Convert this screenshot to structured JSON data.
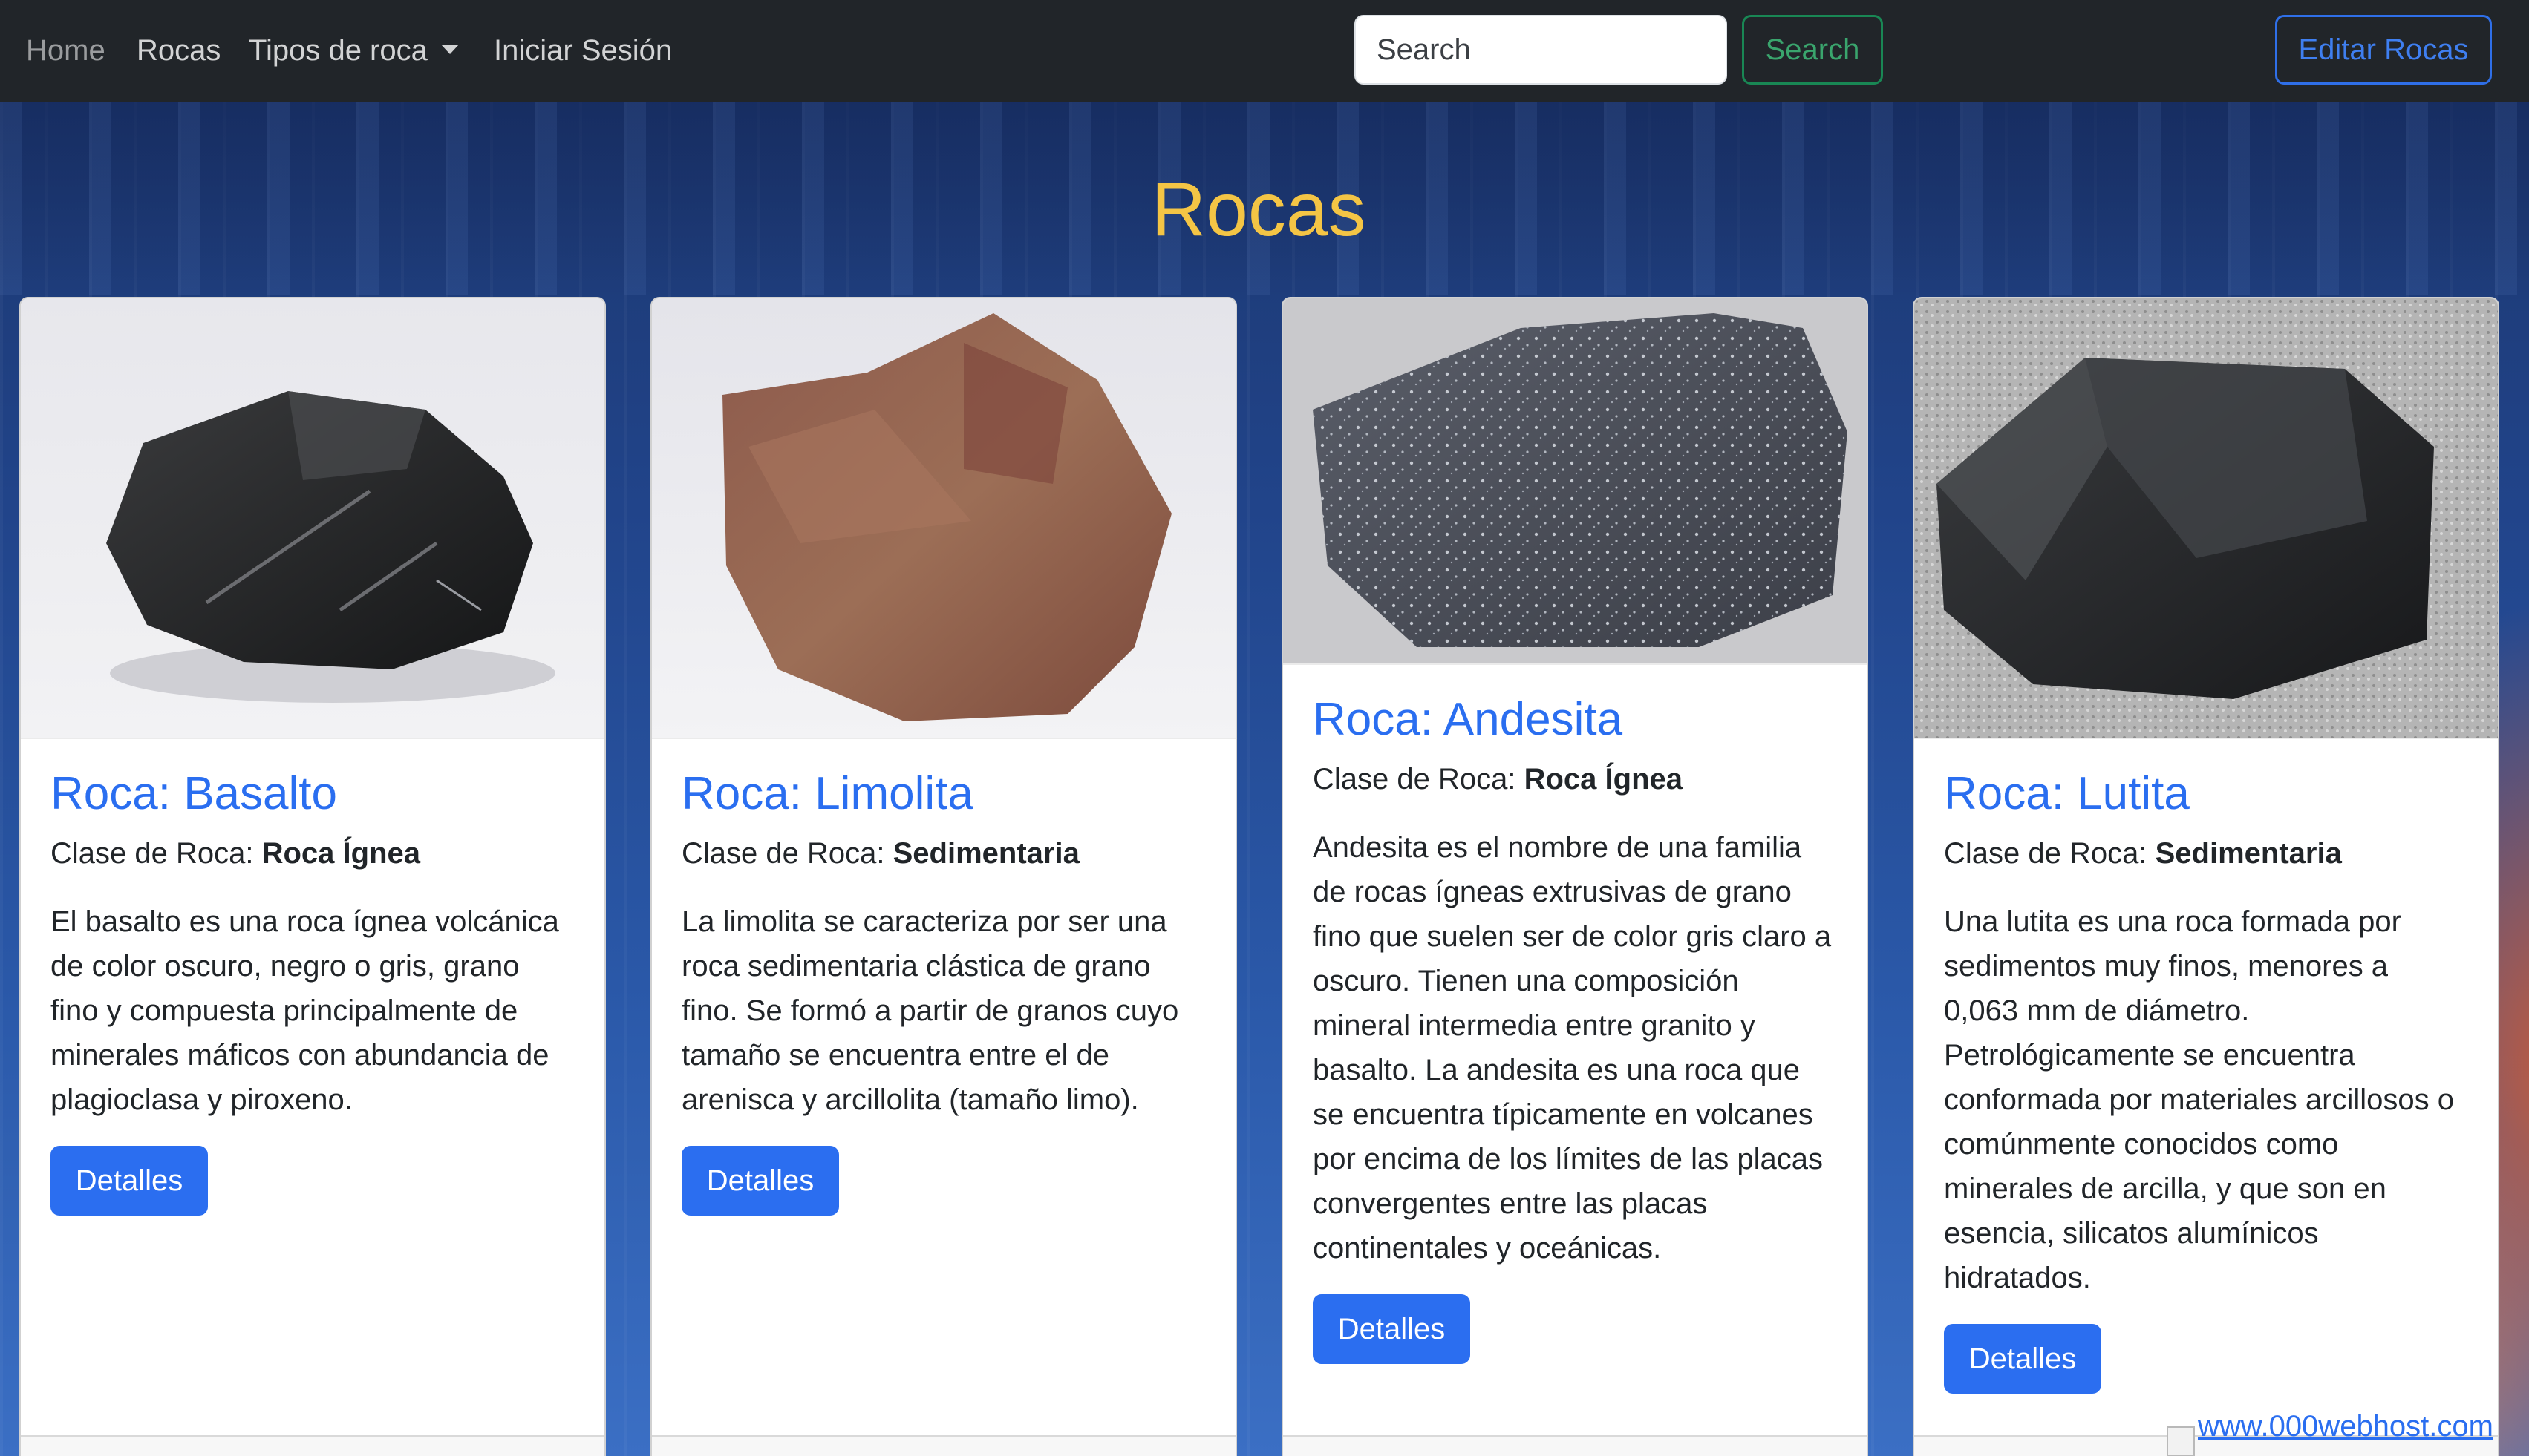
{
  "navbar": {
    "links": {
      "home": "Home",
      "rocas": "Rocas",
      "tipos": "Tipos de roca",
      "login": "Iniciar Sesión"
    },
    "search": {
      "placeholder": "Search",
      "button_label": "Search"
    },
    "edit_button_label": "Editar Rocas"
  },
  "main": {
    "title": "Rocas"
  },
  "cards": [
    {
      "title": "Roca: Basalto",
      "class_label": "Clase de Roca:",
      "class_value": "Roca Ígnea",
      "description": "El basalto es una roca ígnea volcánica de color oscuro, negro o gris, grano fino y compuesta principalmente de minerales máficos con abundancia de plagioclasa y piroxeno.",
      "button_label": "Detalles"
    },
    {
      "title": "Roca: Limolita",
      "class_label": "Clase de Roca:",
      "class_value": "Sedimentaria",
      "description": "La limolita se caracteriza por ser una roca sedimentaria clástica de grano fino. Se formó a partir de granos cuyo tamaño se encuentra entre el de arenisca y arcillolita (tamaño limo).",
      "button_label": "Detalles"
    },
    {
      "title": "Roca: Andesita",
      "class_label": "Clase de Roca:",
      "class_value": "Roca Ígnea",
      "description": "Andesita es el nombre de una familia de rocas ígneas extrusivas de grano fino que suelen ser de color gris claro a oscuro. Tienen una composición mineral intermedia entre granito y basalto. La andesita es una roca que se encuentra típicamente en volcanes por encima de los límites de las placas convergentes entre las placas continentales y oceánicas.",
      "button_label": "Detalles"
    },
    {
      "title": "Roca: Lutita",
      "class_label": "Clase de Roca:",
      "class_value": "Sedimentaria",
      "description": "Una lutita es una roca formada por sedimentos muy finos, menores a 0,063 mm de diámetro. Petrológicamente se encuentra conformada por materiales arcillosos o comúnmente conocidos como minerales de arcilla, y que son en esencia, silicatos alumínicos hidratados.",
      "button_label": "Detalles"
    }
  ],
  "watermark": {
    "text": "www.000webhost.com"
  },
  "colors": {
    "navbar_bg": "#212529",
    "title": "#f4c545",
    "card_title": "#2a6ef0",
    "primary_button": "#2b6ef0",
    "search_button": "#198754"
  }
}
